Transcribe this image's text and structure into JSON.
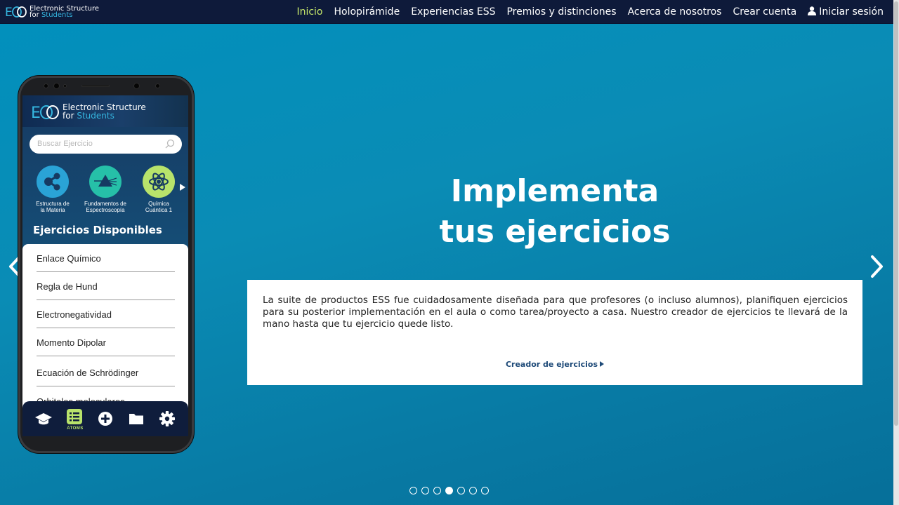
{
  "brand": {
    "line1": "Electronic Structure",
    "line2": "for",
    "line2_accent": "Students",
    "logo_icon": "ess-logo-icon"
  },
  "nav": {
    "items": [
      {
        "label": "Inicio",
        "active": true
      },
      {
        "label": "Holopirámide",
        "active": false
      },
      {
        "label": "Experiencias ESS",
        "active": false
      },
      {
        "label": "Premios y distinciones",
        "active": false
      },
      {
        "label": "Acerca de nosotros",
        "active": false
      },
      {
        "label": "Crear cuenta",
        "active": false
      }
    ],
    "login": {
      "label": "Iniciar sesión",
      "icon": "user-icon"
    }
  },
  "phone": {
    "app_title_line1": "Electronic Structure",
    "app_title_line2": "for",
    "app_title_accent": "Students",
    "search_placeholder": "Buscar Ejercicio",
    "categories": [
      {
        "label1": "Estructura de",
        "label2": "la Materia",
        "icon": "molecule-icon",
        "color": "#2aa3d6"
      },
      {
        "label1": "Fundamentos de",
        "label2": "Espectroscopía",
        "icon": "prism-icon",
        "color": "#26c0a8"
      },
      {
        "label1": "Química",
        "label2": "Cuántica 1",
        "icon": "atom-icon",
        "color": "#b8e36b"
      }
    ],
    "section_title": "Ejercicios Disponibles",
    "exercises": [
      "Enlace Químico",
      "Regla de Hund",
      "Electronegatividad",
      "Momento Dipolar",
      "Ecuación de Schrödinger",
      "Orbitales moleculares"
    ],
    "bottom_bar": {
      "active_label": "ATOMS",
      "icons": [
        "graduation-cap-icon",
        "list-icon",
        "plus-circle-icon",
        "folder-icon",
        "gear-icon"
      ]
    }
  },
  "slide": {
    "headline_line1": "Implementa",
    "headline_line2": "tus ejercicios",
    "body": "La suite de productos ESS fue cuidadosamente diseñada para que profesores (o incluso alumnos), planifiquen ejercicios para su posterior implementación en el aula o como tarea/proyecto a casa. Nuestro creador de ejercicios te llevará de la mano hasta que tu ejercicio quede listo.",
    "link_label": "Creador de ejercicios"
  },
  "carousel": {
    "total_slides": 7,
    "active_index": 3
  },
  "colors": {
    "nav_bg": "#0e1a3a",
    "active_nav": "#c7e86b",
    "accent": "#35b6e0",
    "link": "#1e4a78"
  }
}
